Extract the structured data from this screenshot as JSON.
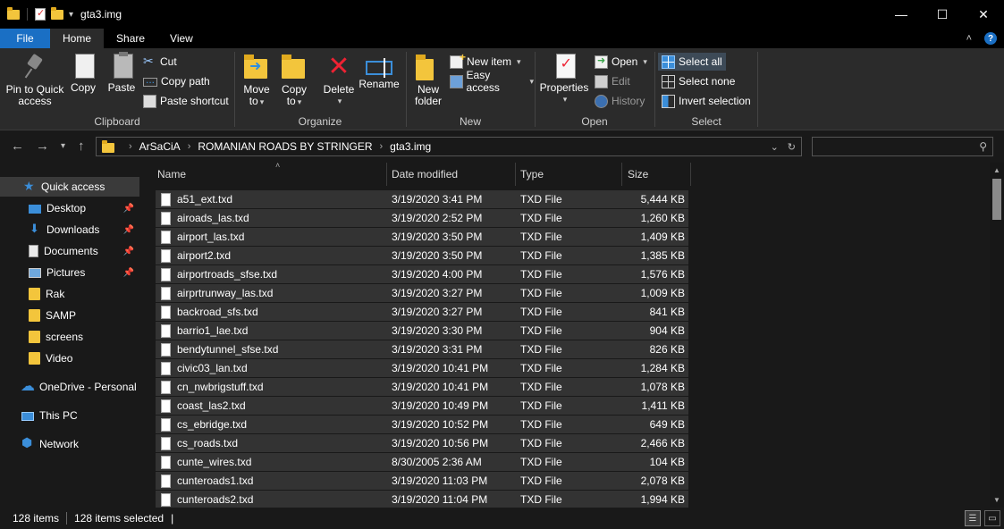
{
  "window": {
    "title": "gta3.img",
    "minimize": "—",
    "maximize": "☐",
    "close": "✕"
  },
  "tabs": [
    {
      "label": "File"
    },
    {
      "label": "Home"
    },
    {
      "label": "Share"
    },
    {
      "label": "View"
    }
  ],
  "ribbon": {
    "clipboard": {
      "label": "Clipboard",
      "pin_line1": "Pin to Quick",
      "pin_line2": "access",
      "copy": "Copy",
      "paste": "Paste",
      "cut": "Cut",
      "copy_path": "Copy path",
      "paste_shortcut": "Paste shortcut"
    },
    "organize": {
      "label": "Organize",
      "move_line1": "Move",
      "move_line2": "to",
      "copy_line1": "Copy",
      "copy_line2": "to",
      "delete": "Delete",
      "rename": "Rename"
    },
    "new": {
      "label": "New",
      "folder_line1": "New",
      "folder_line2": "folder",
      "new_item": "New item",
      "easy_access": "Easy access"
    },
    "open": {
      "label": "Open",
      "properties": "Properties",
      "open": "Open",
      "edit": "Edit",
      "history": "History"
    },
    "select": {
      "label": "Select",
      "select_all": "Select all",
      "select_none": "Select none",
      "invert": "Invert selection"
    }
  },
  "address": {
    "crumbs": [
      "ArSaCiA",
      "ROMANIAN ROADS BY STRINGER",
      "gta3.img"
    ],
    "search_placeholder": ""
  },
  "sidebar": {
    "items": [
      {
        "label": "Quick access",
        "icon": "star-icon"
      },
      {
        "label": "Desktop",
        "icon": "desktop-icon"
      },
      {
        "label": "Downloads",
        "icon": "downloads-icon"
      },
      {
        "label": "Documents",
        "icon": "documents-icon"
      },
      {
        "label": "Pictures",
        "icon": "pictures-icon"
      },
      {
        "label": "Rak",
        "icon": "folder-icon"
      },
      {
        "label": "SAMP",
        "icon": "folder-icon"
      },
      {
        "label": "screens",
        "icon": "folder-icon"
      },
      {
        "label": "Video",
        "icon": "folder-icon"
      },
      {
        "label": "OneDrive - Personal",
        "icon": "onedrive-icon"
      },
      {
        "label": "This PC",
        "icon": "this-pc-icon"
      },
      {
        "label": "Network",
        "icon": "network-icon"
      }
    ]
  },
  "columns": {
    "name": "Name",
    "date": "Date modified",
    "type": "Type",
    "size": "Size"
  },
  "files": [
    {
      "name": "a51_ext.txd",
      "date": "3/19/2020 3:41 PM",
      "type": "TXD File",
      "size": "5,444 KB"
    },
    {
      "name": "airoads_las.txd",
      "date": "3/19/2020 2:52 PM",
      "type": "TXD File",
      "size": "1,260 KB"
    },
    {
      "name": "airport_las.txd",
      "date": "3/19/2020 3:50 PM",
      "type": "TXD File",
      "size": "1,409 KB"
    },
    {
      "name": "airport2.txd",
      "date": "3/19/2020 3:50 PM",
      "type": "TXD File",
      "size": "1,385 KB"
    },
    {
      "name": "airportroads_sfse.txd",
      "date": "3/19/2020 4:00 PM",
      "type": "TXD File",
      "size": "1,576 KB"
    },
    {
      "name": "airprtrunway_las.txd",
      "date": "3/19/2020 3:27 PM",
      "type": "TXD File",
      "size": "1,009 KB"
    },
    {
      "name": "backroad_sfs.txd",
      "date": "3/19/2020 3:27 PM",
      "type": "TXD File",
      "size": "841 KB"
    },
    {
      "name": "barrio1_lae.txd",
      "date": "3/19/2020 3:30 PM",
      "type": "TXD File",
      "size": "904 KB"
    },
    {
      "name": "bendytunnel_sfse.txd",
      "date": "3/19/2020 3:31 PM",
      "type": "TXD File",
      "size": "826 KB"
    },
    {
      "name": "civic03_lan.txd",
      "date": "3/19/2020 10:41 PM",
      "type": "TXD File",
      "size": "1,284 KB"
    },
    {
      "name": "cn_nwbrigstuff.txd",
      "date": "3/19/2020 10:41 PM",
      "type": "TXD File",
      "size": "1,078 KB"
    },
    {
      "name": "coast_las2.txd",
      "date": "3/19/2020 10:49 PM",
      "type": "TXD File",
      "size": "1,411 KB"
    },
    {
      "name": "cs_ebridge.txd",
      "date": "3/19/2020 10:52 PM",
      "type": "TXD File",
      "size": "649 KB"
    },
    {
      "name": "cs_roads.txd",
      "date": "3/19/2020 10:56 PM",
      "type": "TXD File",
      "size": "2,466 KB"
    },
    {
      "name": "cunte_wires.txd",
      "date": "8/30/2005 2:36 AM",
      "type": "TXD File",
      "size": "104 KB"
    },
    {
      "name": "cunteroads1.txd",
      "date": "3/19/2020 11:03 PM",
      "type": "TXD File",
      "size": "2,078 KB"
    },
    {
      "name": "cunteroads2.txd",
      "date": "3/19/2020 11:04 PM",
      "type": "TXD File",
      "size": "1,994 KB"
    }
  ],
  "status": {
    "count": "128 items",
    "selected": "128 items selected",
    "cursor": "|"
  },
  "colors": {
    "accent": "#1a6fc4",
    "row_selected": "#333333",
    "folder": "#f3c53c"
  }
}
